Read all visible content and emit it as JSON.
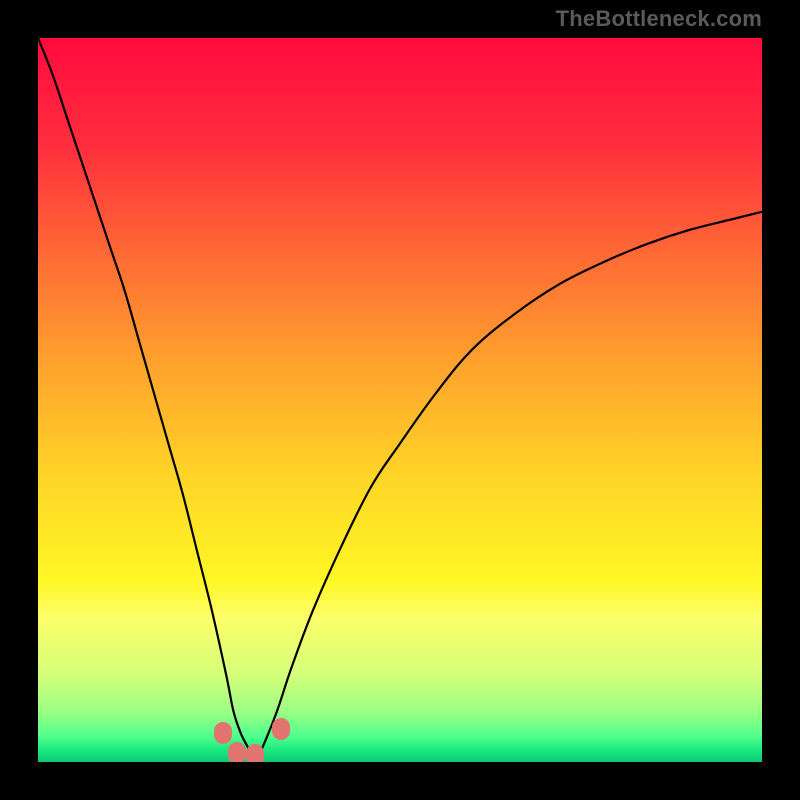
{
  "watermark": {
    "text": "TheBottleneck.com"
  },
  "chart_data": {
    "type": "line",
    "title": "",
    "xlabel": "",
    "ylabel": "",
    "xlim": [
      0,
      100
    ],
    "ylim": [
      0,
      100
    ],
    "grid": false,
    "background": {
      "type": "vertical-gradient",
      "stops": [
        {
          "pos": 0.0,
          "color": "#ff0b3e"
        },
        {
          "pos": 0.15,
          "color": "#ff2e3d"
        },
        {
          "pos": 0.3,
          "color": "#ff6a35"
        },
        {
          "pos": 0.45,
          "color": "#ffa22d"
        },
        {
          "pos": 0.6,
          "color": "#ffd327"
        },
        {
          "pos": 0.75,
          "color": "#fff726"
        },
        {
          "pos": 0.8,
          "color": "#fdff68"
        },
        {
          "pos": 0.88,
          "color": "#d4ff7a"
        },
        {
          "pos": 0.93,
          "color": "#9bff84"
        },
        {
          "pos": 0.965,
          "color": "#4fff8c"
        },
        {
          "pos": 0.985,
          "color": "#17e77e"
        },
        {
          "pos": 1.0,
          "color": "#0fc774"
        }
      ]
    },
    "series": [
      {
        "name": "bottleneck-curve",
        "color": "#000000",
        "stroke_width": 2.2,
        "x": [
          0,
          2,
          4,
          6,
          8,
          10,
          12,
          14,
          16,
          18,
          20,
          22,
          24,
          26,
          27,
          28,
          29,
          30,
          31,
          33,
          35,
          38,
          42,
          46,
          50,
          55,
          60,
          66,
          72,
          78,
          84,
          90,
          96,
          100
        ],
        "y": [
          100,
          95,
          89,
          83,
          77,
          71,
          65,
          58,
          51,
          44,
          37,
          29,
          21,
          12,
          7,
          4,
          2,
          0,
          2,
          7,
          13,
          21,
          30,
          38,
          44,
          51,
          57,
          62,
          66,
          69,
          71.5,
          73.5,
          75,
          76
        ]
      }
    ],
    "markers": [
      {
        "name": "trough-marker",
        "shape": "rounded",
        "color": "#e1746f",
        "x": 25.5,
        "y": 4
      },
      {
        "name": "trough-marker",
        "shape": "rounded",
        "color": "#e1746f",
        "x": 27.5,
        "y": 1.3
      },
      {
        "name": "trough-marker",
        "shape": "rounded",
        "color": "#e1746f",
        "x": 30.0,
        "y": 0.9
      },
      {
        "name": "trough-marker",
        "shape": "rounded",
        "color": "#e1746f",
        "x": 33.5,
        "y": 4.5
      }
    ],
    "annotations": []
  }
}
